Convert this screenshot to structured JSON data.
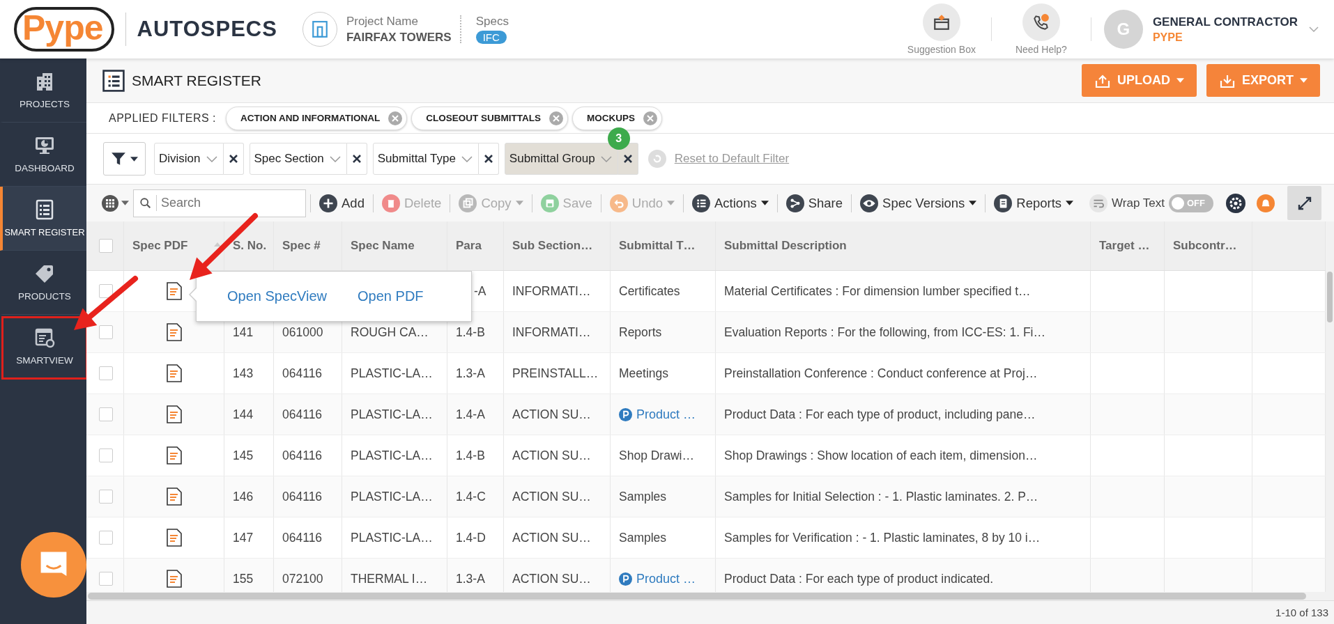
{
  "header": {
    "logo": "Pype",
    "product": "AUTOSPECS",
    "project_label": "Project Name",
    "project_name": "FAIRFAX TOWERS",
    "specs_label": "Specs",
    "specs_badge": "IFC",
    "actions": [
      {
        "label": "Suggestion Box",
        "kind": "suggestion"
      },
      {
        "label": "Need Help?",
        "kind": "help"
      }
    ],
    "user": {
      "avatar": "G",
      "name": "GENERAL CONTRACTOR",
      "company": "PYPE"
    }
  },
  "sidebar": {
    "items": [
      {
        "label": "PROJECTS",
        "selected": false,
        "annotated": false
      },
      {
        "label": "DASHBOARD",
        "selected": false,
        "annotated": false
      },
      {
        "label": "SMART REGISTER",
        "selected": true,
        "annotated": false
      },
      {
        "label": "PRODUCTS",
        "selected": false,
        "annotated": false
      },
      {
        "label": "SMARTVIEW",
        "selected": false,
        "annotated": true
      }
    ]
  },
  "page": {
    "title": "SMART REGISTER",
    "buttons": [
      {
        "label": "UPLOAD",
        "kind": "upload"
      },
      {
        "label": "EXPORT",
        "kind": "export"
      }
    ]
  },
  "applied_filters": {
    "label": "APPLIED FILTERS :",
    "chips": [
      "ACTION AND INFORMATIONAL",
      "CLOSEOUT SUBMITTALS",
      "MOCKUPS"
    ]
  },
  "filter_bar": {
    "dropdowns": [
      {
        "label": "Division",
        "selected": false
      },
      {
        "label": "Spec Section",
        "selected": false
      },
      {
        "label": "Submittal Type",
        "selected": false
      },
      {
        "label": "Submittal Group",
        "selected": true,
        "badge": "3"
      }
    ],
    "reset": "Reset to Default Filter"
  },
  "toolbar": {
    "search_placeholder": "Search",
    "actions": [
      {
        "label": "Add",
        "disabled": false,
        "caret": false
      },
      {
        "label": "Delete",
        "disabled": true,
        "caret": false
      },
      {
        "label": "Copy",
        "disabled": true,
        "caret": true
      },
      {
        "label": "Save",
        "disabled": true,
        "caret": false
      },
      {
        "label": "Undo",
        "disabled": true,
        "caret": true
      },
      {
        "label": "Actions",
        "disabled": false,
        "caret": true
      },
      {
        "label": "Share",
        "disabled": false,
        "caret": false
      },
      {
        "label": "Spec Versions",
        "disabled": false,
        "caret": true
      },
      {
        "label": "Reports",
        "disabled": false,
        "caret": true
      }
    ],
    "wrap_text": {
      "label": "Wrap Text",
      "on": false,
      "state": "OFF"
    }
  },
  "table": {
    "header_checked": false,
    "columns": [
      {
        "label": "Spec PDF",
        "sorted": true
      },
      {
        "label": "S. No.",
        "sorted": false
      },
      {
        "label": "Spec #",
        "sorted": false
      },
      {
        "label": "Spec Name",
        "sorted": false
      },
      {
        "label": "Para",
        "sorted": false
      },
      {
        "label": "Sub Section…",
        "sorted": false
      },
      {
        "label": "Submittal T…",
        "sorted": false
      },
      {
        "label": "Submittal Description",
        "sorted": false
      },
      {
        "label": "Target …",
        "sorted": false
      },
      {
        "label": "Subcontr…",
        "sorted": false
      }
    ],
    "rows": [
      {
        "checked": false,
        "para": "-A",
        "sub_section": "INFORMATI…",
        "submittal_type": "Certificates",
        "type_link": false,
        "description": "Material Certificates : For dimension lumber specified t…",
        "popover": [
          "Open SpecView",
          "Open PDF"
        ]
      },
      {
        "checked": false,
        "s_no": "141",
        "spec_no": "061000",
        "spec_name": "ROUGH CA…",
        "para": "1.4-B",
        "sub_section": "INFORMATI…",
        "submittal_type": "Reports",
        "type_link": false,
        "description": "Evaluation Reports : For the following, from ICC-ES: 1. Fi…"
      },
      {
        "checked": false,
        "s_no": "143",
        "spec_no": "064116",
        "spec_name": "PLASTIC-LA…",
        "para": "1.3-A",
        "sub_section": "PREINSTALL…",
        "submittal_type": "Meetings",
        "type_link": false,
        "description": "Preinstallation Conference : Conduct conference at Proj…"
      },
      {
        "checked": false,
        "s_no": "144",
        "spec_no": "064116",
        "spec_name": "PLASTIC-LA…",
        "para": "1.4-A",
        "sub_section": "ACTION SU…",
        "submittal_type": "Product …",
        "type_link": true,
        "description": "Product Data : For each type of product, including pane…"
      },
      {
        "checked": false,
        "s_no": "145",
        "spec_no": "064116",
        "spec_name": "PLASTIC-LA…",
        "para": "1.4-B",
        "sub_section": "ACTION SU…",
        "submittal_type": "Shop Drawi…",
        "type_link": false,
        "description": "Shop Drawings : Show location of each item, dimension…"
      },
      {
        "checked": false,
        "s_no": "146",
        "spec_no": "064116",
        "spec_name": "PLASTIC-LA…",
        "para": "1.4-C",
        "sub_section": "ACTION SU…",
        "submittal_type": "Samples",
        "type_link": false,
        "description": "Samples for Initial Selection : - 1. Plastic laminates. 2. P…"
      },
      {
        "checked": false,
        "s_no": "147",
        "spec_no": "064116",
        "spec_name": "PLASTIC-LA…",
        "para": "1.4-D",
        "sub_section": "ACTION SU…",
        "submittal_type": "Samples",
        "type_link": false,
        "description": "Samples for Verification : - 1. Plastic laminates, 8 by 10 i…"
      },
      {
        "checked": false,
        "s_no": "155",
        "spec_no": "072100",
        "spec_name": "THERMAL I…",
        "para": "1.3-A",
        "sub_section": "ACTION SU…",
        "submittal_type": "Product …",
        "type_link": true,
        "description": "Product Data : For each type of product indicated."
      }
    ],
    "pagination": "1-10 of 133"
  },
  "annotations": [
    {
      "kind": "arrow"
    },
    {
      "kind": "arrow"
    }
  ]
}
